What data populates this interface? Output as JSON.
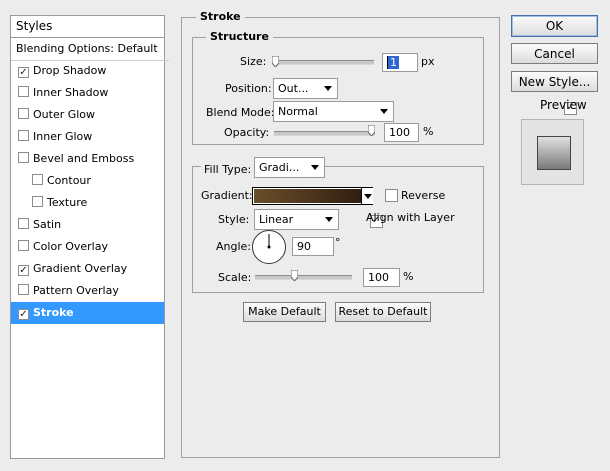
{
  "left": {
    "title": "Styles",
    "items": [
      {
        "label": "Blending Options: Default",
        "checked": null
      },
      {
        "label": "Drop Shadow",
        "checked": true
      },
      {
        "label": "Inner Shadow",
        "checked": false
      },
      {
        "label": "Outer Glow",
        "checked": false
      },
      {
        "label": "Inner Glow",
        "checked": false
      },
      {
        "label": "Bevel and Emboss",
        "checked": false
      },
      {
        "label": "Contour",
        "checked": false
      },
      {
        "label": "Texture",
        "checked": false
      },
      {
        "label": "Satin",
        "checked": false
      },
      {
        "label": "Color Overlay",
        "checked": false
      },
      {
        "label": "Gradient Overlay",
        "checked": true
      },
      {
        "label": "Pattern Overlay",
        "checked": false
      },
      {
        "label": "Stroke",
        "checked": true
      }
    ],
    "selected": "Stroke"
  },
  "stroke": {
    "section_title": "Stroke",
    "structure_title": "Structure",
    "size_label": "Size:",
    "size_value": "1",
    "size_unit": "px",
    "size_slider_fraction": 0.0,
    "position_label": "Position:",
    "position_value": "Out...",
    "blend_label": "Blend Mode:",
    "blend_value": "Normal",
    "opacity_label": "Opacity:",
    "opacity_value": "100",
    "opacity_unit": "%",
    "opacity_slider_fraction": 1.0,
    "fill_type_label": "Fill Type:",
    "fill_type_value": "Gradi...",
    "gradient_label": "Gradient:",
    "gradient_colors": [
      "#6b4e2c",
      "#2a1a0c"
    ],
    "reverse_label": "Reverse",
    "reverse_checked": false,
    "style_label": "Style:",
    "style_value": "Linear",
    "align_label": "Align with Layer",
    "align_checked": true,
    "angle_label": "Angle:",
    "angle_value": "90",
    "angle_unit": "°",
    "scale_label": "Scale:",
    "scale_value": "100",
    "scale_unit": "%",
    "scale_slider_fraction": 0.4,
    "make_default": "Make Default",
    "reset_default": "Reset to Default"
  },
  "right": {
    "ok": "OK",
    "cancel": "Cancel",
    "new_style": "New Style...",
    "preview_label": "Preview",
    "preview_checked": true
  }
}
